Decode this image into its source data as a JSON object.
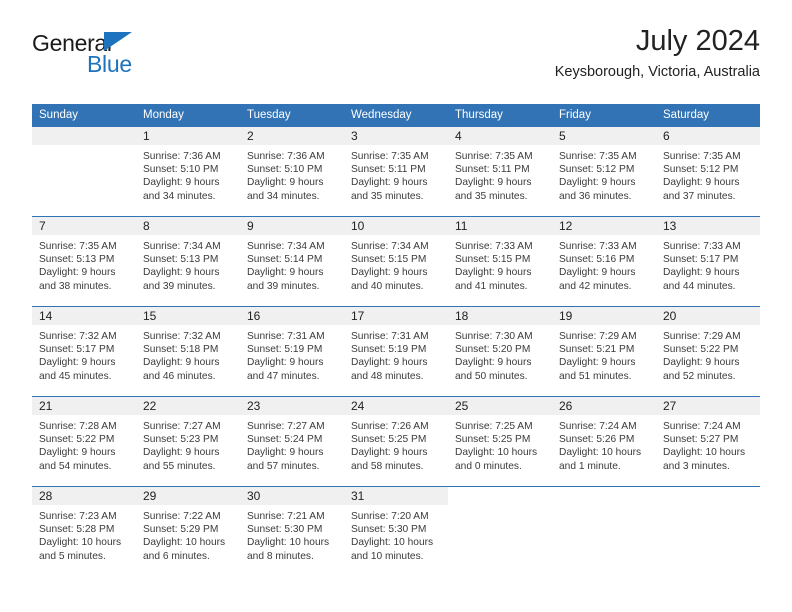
{
  "brand": {
    "name_top": "General",
    "name_bottom": "Blue",
    "accent_color": "#1e73be"
  },
  "header": {
    "title": "July 2024",
    "subtitle": "Keysborough, Victoria, Australia"
  },
  "calendar": {
    "header_color": "#3173b4",
    "daynum_band_color": "#f0f0f0",
    "weekday_headers": [
      "Sunday",
      "Monday",
      "Tuesday",
      "Wednesday",
      "Thursday",
      "Friday",
      "Saturday"
    ],
    "weeks": [
      [
        {
          "day": "",
          "sunrise": "",
          "sunset": "",
          "daylight1": "",
          "daylight2": ""
        },
        {
          "day": "1",
          "sunrise": "Sunrise: 7:36 AM",
          "sunset": "Sunset: 5:10 PM",
          "daylight1": "Daylight: 9 hours",
          "daylight2": "and 34 minutes."
        },
        {
          "day": "2",
          "sunrise": "Sunrise: 7:36 AM",
          "sunset": "Sunset: 5:10 PM",
          "daylight1": "Daylight: 9 hours",
          "daylight2": "and 34 minutes."
        },
        {
          "day": "3",
          "sunrise": "Sunrise: 7:35 AM",
          "sunset": "Sunset: 5:11 PM",
          "daylight1": "Daylight: 9 hours",
          "daylight2": "and 35 minutes."
        },
        {
          "day": "4",
          "sunrise": "Sunrise: 7:35 AM",
          "sunset": "Sunset: 5:11 PM",
          "daylight1": "Daylight: 9 hours",
          "daylight2": "and 35 minutes."
        },
        {
          "day": "5",
          "sunrise": "Sunrise: 7:35 AM",
          "sunset": "Sunset: 5:12 PM",
          "daylight1": "Daylight: 9 hours",
          "daylight2": "and 36 minutes."
        },
        {
          "day": "6",
          "sunrise": "Sunrise: 7:35 AM",
          "sunset": "Sunset: 5:12 PM",
          "daylight1": "Daylight: 9 hours",
          "daylight2": "and 37 minutes."
        }
      ],
      [
        {
          "day": "7",
          "sunrise": "Sunrise: 7:35 AM",
          "sunset": "Sunset: 5:13 PM",
          "daylight1": "Daylight: 9 hours",
          "daylight2": "and 38 minutes."
        },
        {
          "day": "8",
          "sunrise": "Sunrise: 7:34 AM",
          "sunset": "Sunset: 5:13 PM",
          "daylight1": "Daylight: 9 hours",
          "daylight2": "and 39 minutes."
        },
        {
          "day": "9",
          "sunrise": "Sunrise: 7:34 AM",
          "sunset": "Sunset: 5:14 PM",
          "daylight1": "Daylight: 9 hours",
          "daylight2": "and 39 minutes."
        },
        {
          "day": "10",
          "sunrise": "Sunrise: 7:34 AM",
          "sunset": "Sunset: 5:15 PM",
          "daylight1": "Daylight: 9 hours",
          "daylight2": "and 40 minutes."
        },
        {
          "day": "11",
          "sunrise": "Sunrise: 7:33 AM",
          "sunset": "Sunset: 5:15 PM",
          "daylight1": "Daylight: 9 hours",
          "daylight2": "and 41 minutes."
        },
        {
          "day": "12",
          "sunrise": "Sunrise: 7:33 AM",
          "sunset": "Sunset: 5:16 PM",
          "daylight1": "Daylight: 9 hours",
          "daylight2": "and 42 minutes."
        },
        {
          "day": "13",
          "sunrise": "Sunrise: 7:33 AM",
          "sunset": "Sunset: 5:17 PM",
          "daylight1": "Daylight: 9 hours",
          "daylight2": "and 44 minutes."
        }
      ],
      [
        {
          "day": "14",
          "sunrise": "Sunrise: 7:32 AM",
          "sunset": "Sunset: 5:17 PM",
          "daylight1": "Daylight: 9 hours",
          "daylight2": "and 45 minutes."
        },
        {
          "day": "15",
          "sunrise": "Sunrise: 7:32 AM",
          "sunset": "Sunset: 5:18 PM",
          "daylight1": "Daylight: 9 hours",
          "daylight2": "and 46 minutes."
        },
        {
          "day": "16",
          "sunrise": "Sunrise: 7:31 AM",
          "sunset": "Sunset: 5:19 PM",
          "daylight1": "Daylight: 9 hours",
          "daylight2": "and 47 minutes."
        },
        {
          "day": "17",
          "sunrise": "Sunrise: 7:31 AM",
          "sunset": "Sunset: 5:19 PM",
          "daylight1": "Daylight: 9 hours",
          "daylight2": "and 48 minutes."
        },
        {
          "day": "18",
          "sunrise": "Sunrise: 7:30 AM",
          "sunset": "Sunset: 5:20 PM",
          "daylight1": "Daylight: 9 hours",
          "daylight2": "and 50 minutes."
        },
        {
          "day": "19",
          "sunrise": "Sunrise: 7:29 AM",
          "sunset": "Sunset: 5:21 PM",
          "daylight1": "Daylight: 9 hours",
          "daylight2": "and 51 minutes."
        },
        {
          "day": "20",
          "sunrise": "Sunrise: 7:29 AM",
          "sunset": "Sunset: 5:22 PM",
          "daylight1": "Daylight: 9 hours",
          "daylight2": "and 52 minutes."
        }
      ],
      [
        {
          "day": "21",
          "sunrise": "Sunrise: 7:28 AM",
          "sunset": "Sunset: 5:22 PM",
          "daylight1": "Daylight: 9 hours",
          "daylight2": "and 54 minutes."
        },
        {
          "day": "22",
          "sunrise": "Sunrise: 7:27 AM",
          "sunset": "Sunset: 5:23 PM",
          "daylight1": "Daylight: 9 hours",
          "daylight2": "and 55 minutes."
        },
        {
          "day": "23",
          "sunrise": "Sunrise: 7:27 AM",
          "sunset": "Sunset: 5:24 PM",
          "daylight1": "Daylight: 9 hours",
          "daylight2": "and 57 minutes."
        },
        {
          "day": "24",
          "sunrise": "Sunrise: 7:26 AM",
          "sunset": "Sunset: 5:25 PM",
          "daylight1": "Daylight: 9 hours",
          "daylight2": "and 58 minutes."
        },
        {
          "day": "25",
          "sunrise": "Sunrise: 7:25 AM",
          "sunset": "Sunset: 5:25 PM",
          "daylight1": "Daylight: 10 hours",
          "daylight2": "and 0 minutes."
        },
        {
          "day": "26",
          "sunrise": "Sunrise: 7:24 AM",
          "sunset": "Sunset: 5:26 PM",
          "daylight1": "Daylight: 10 hours",
          "daylight2": "and 1 minute."
        },
        {
          "day": "27",
          "sunrise": "Sunrise: 7:24 AM",
          "sunset": "Sunset: 5:27 PM",
          "daylight1": "Daylight: 10 hours",
          "daylight2": "and 3 minutes."
        }
      ],
      [
        {
          "day": "28",
          "sunrise": "Sunrise: 7:23 AM",
          "sunset": "Sunset: 5:28 PM",
          "daylight1": "Daylight: 10 hours",
          "daylight2": "and 5 minutes."
        },
        {
          "day": "29",
          "sunrise": "Sunrise: 7:22 AM",
          "sunset": "Sunset: 5:29 PM",
          "daylight1": "Daylight: 10 hours",
          "daylight2": "and 6 minutes."
        },
        {
          "day": "30",
          "sunrise": "Sunrise: 7:21 AM",
          "sunset": "Sunset: 5:30 PM",
          "daylight1": "Daylight: 10 hours",
          "daylight2": "and 8 minutes."
        },
        {
          "day": "31",
          "sunrise": "Sunrise: 7:20 AM",
          "sunset": "Sunset: 5:30 PM",
          "daylight1": "Daylight: 10 hours",
          "daylight2": "and 10 minutes."
        },
        {
          "day": "",
          "sunrise": "",
          "sunset": "",
          "daylight1": "",
          "daylight2": ""
        },
        {
          "day": "",
          "sunrise": "",
          "sunset": "",
          "daylight1": "",
          "daylight2": ""
        },
        {
          "day": "",
          "sunrise": "",
          "sunset": "",
          "daylight1": "",
          "daylight2": ""
        }
      ]
    ]
  }
}
